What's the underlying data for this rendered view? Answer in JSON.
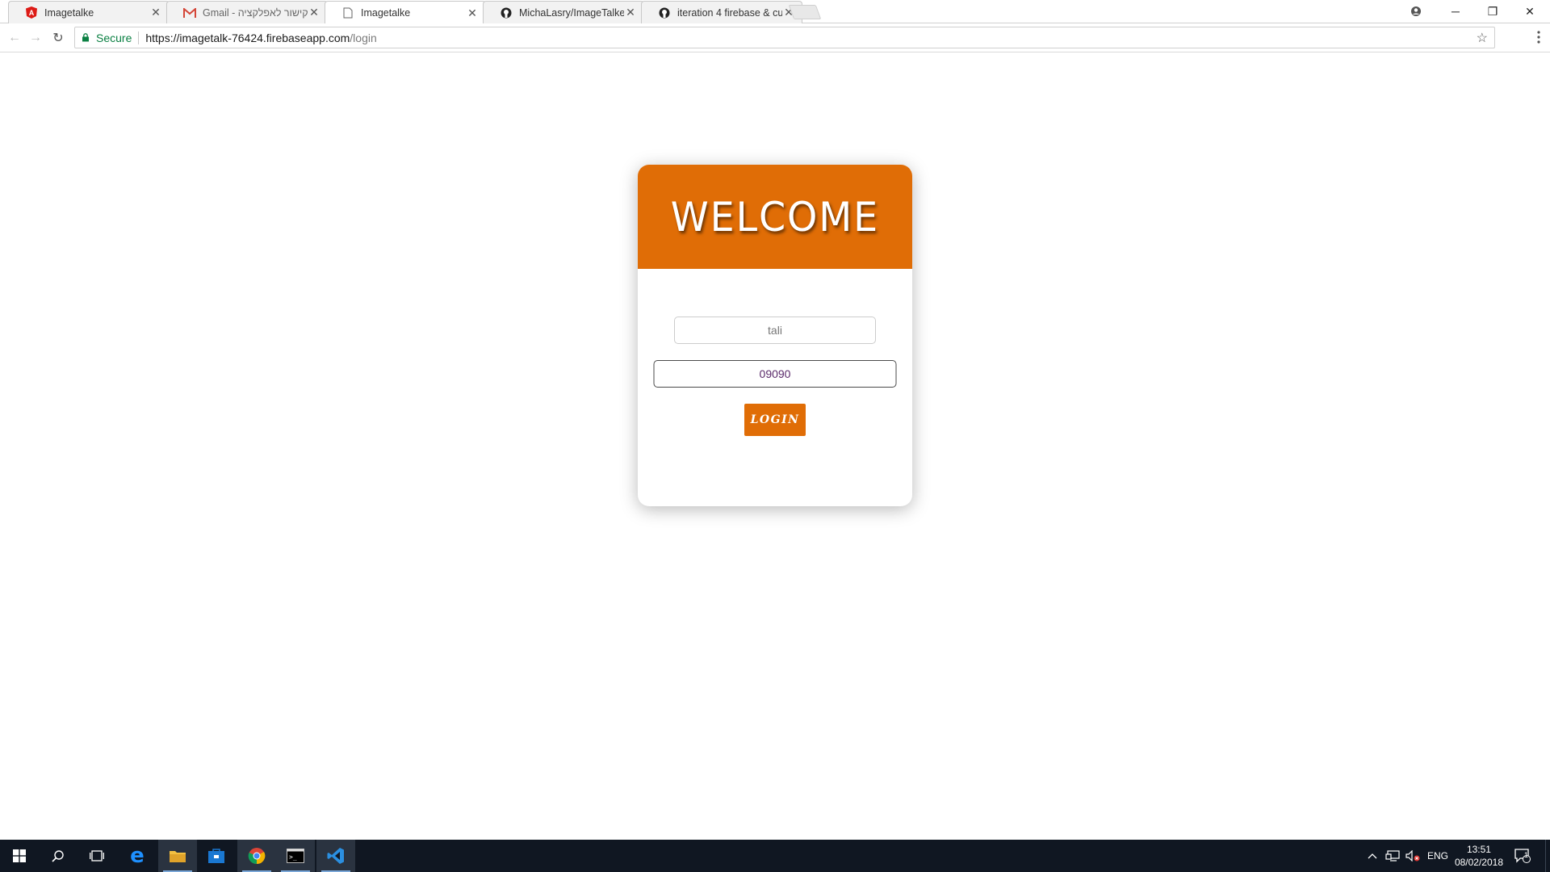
{
  "browser": {
    "tabs": [
      {
        "title": "Imagetalke",
        "icon": "angular-icon"
      },
      {
        "title": "Gmail - קישור לאפלקציה",
        "icon": "gmail-icon"
      },
      {
        "title": "Imagetalke",
        "icon": "page-icon",
        "active": true
      },
      {
        "title": "MichaLasry/ImageTalke",
        "icon": "github-icon"
      },
      {
        "title": "iteration 4 firebase & cu",
        "icon": "github-icon"
      }
    ],
    "secure_label": "Secure",
    "url_host": "https://imagetalk-76424.firebaseapp.com",
    "url_path": "/login"
  },
  "login": {
    "heading": "WELCOME",
    "username_value": "tali",
    "password_value": "09090",
    "button_label": "LOGIN"
  },
  "colors": {
    "accent": "#e06d06",
    "taskbar": "#101722"
  },
  "taskbar": {
    "language": "ENG",
    "time": "13:51",
    "date": "08/02/2018",
    "notification_count": "1"
  }
}
